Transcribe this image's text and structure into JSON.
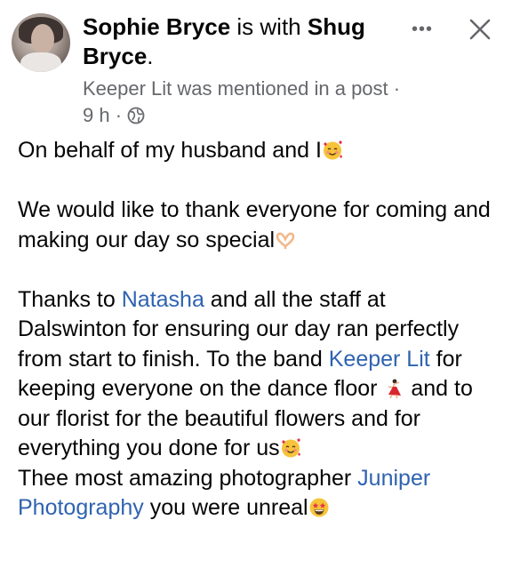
{
  "post": {
    "author": "Sophie Bryce",
    "with_text": " is with ",
    "tagged": "Shug Bryce",
    "period": ".",
    "meta_mention": "Keeper Lit was mentioned in a post",
    "meta_time_sep": " · ",
    "meta_time": "9 h",
    "meta_sep2": " · ",
    "more_label": "•••",
    "p1": "On behalf of my husband and I",
    "p2": "We would like to thank everyone for coming and making our day so special",
    "p3_a": "Thanks to ",
    "p3_link1": "Natasha",
    "p3_b": " and all the staff at Dalswinton for ensuring our day ran perfectly from start to finish. To the band ",
    "p3_link2": "Keeper Lit",
    "p3_c": " for keeping everyone on the dance floor ",
    "p3_d": " and to our florist for the beautiful flowers and for everything you done for us",
    "p4_a": "Thee most amazing photographer ",
    "p4_link": "Juniper Photography",
    "p4_b": " you were unreal",
    "icons": [
      "avatar",
      "more-icon",
      "close-icon",
      "globe-icon",
      "smiling-face-with-hearts-emoji",
      "heart-hands-emoji",
      "dancer-emoji",
      "star-struck-emoji"
    ],
    "link_color": "#2f63b0",
    "meta_color": "#65676b"
  }
}
